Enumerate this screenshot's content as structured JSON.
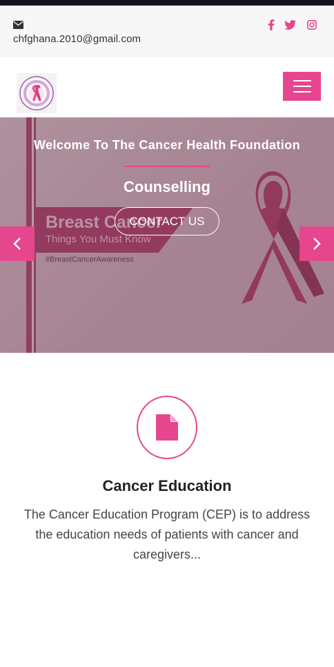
{
  "topbar": {
    "email": "chfghana.2010@gmail.com",
    "icons": {
      "mail": "envelope-icon",
      "facebook": "facebook-icon",
      "twitter": "twitter-icon",
      "instagram": "instagram-icon"
    }
  },
  "navbar": {
    "logo_icon": "cancer-health-foundation-logo",
    "menu_icon": "hamburger-menu-icon"
  },
  "hero": {
    "welcome": "Welcome To The Cancer Health Foundation",
    "heading": "Counselling",
    "cta_label": "CONTACT US",
    "banner": {
      "title": "Breast Cancer",
      "subtitle": "Things You Must Know",
      "hashtag": "#BreastCancerAwareness"
    },
    "prev_icon": "chevron-left-icon",
    "next_icon": "chevron-right-icon"
  },
  "feature": {
    "icon": "document-icon",
    "title": "Cancer Education",
    "text": "The Cancer Education Program (CEP) is to address the education needs of patients with cancer and caregivers..."
  },
  "colors": {
    "accent": "#e6468e",
    "topbar_bg": "#f7f7f7",
    "status_strip": "#15161b"
  }
}
